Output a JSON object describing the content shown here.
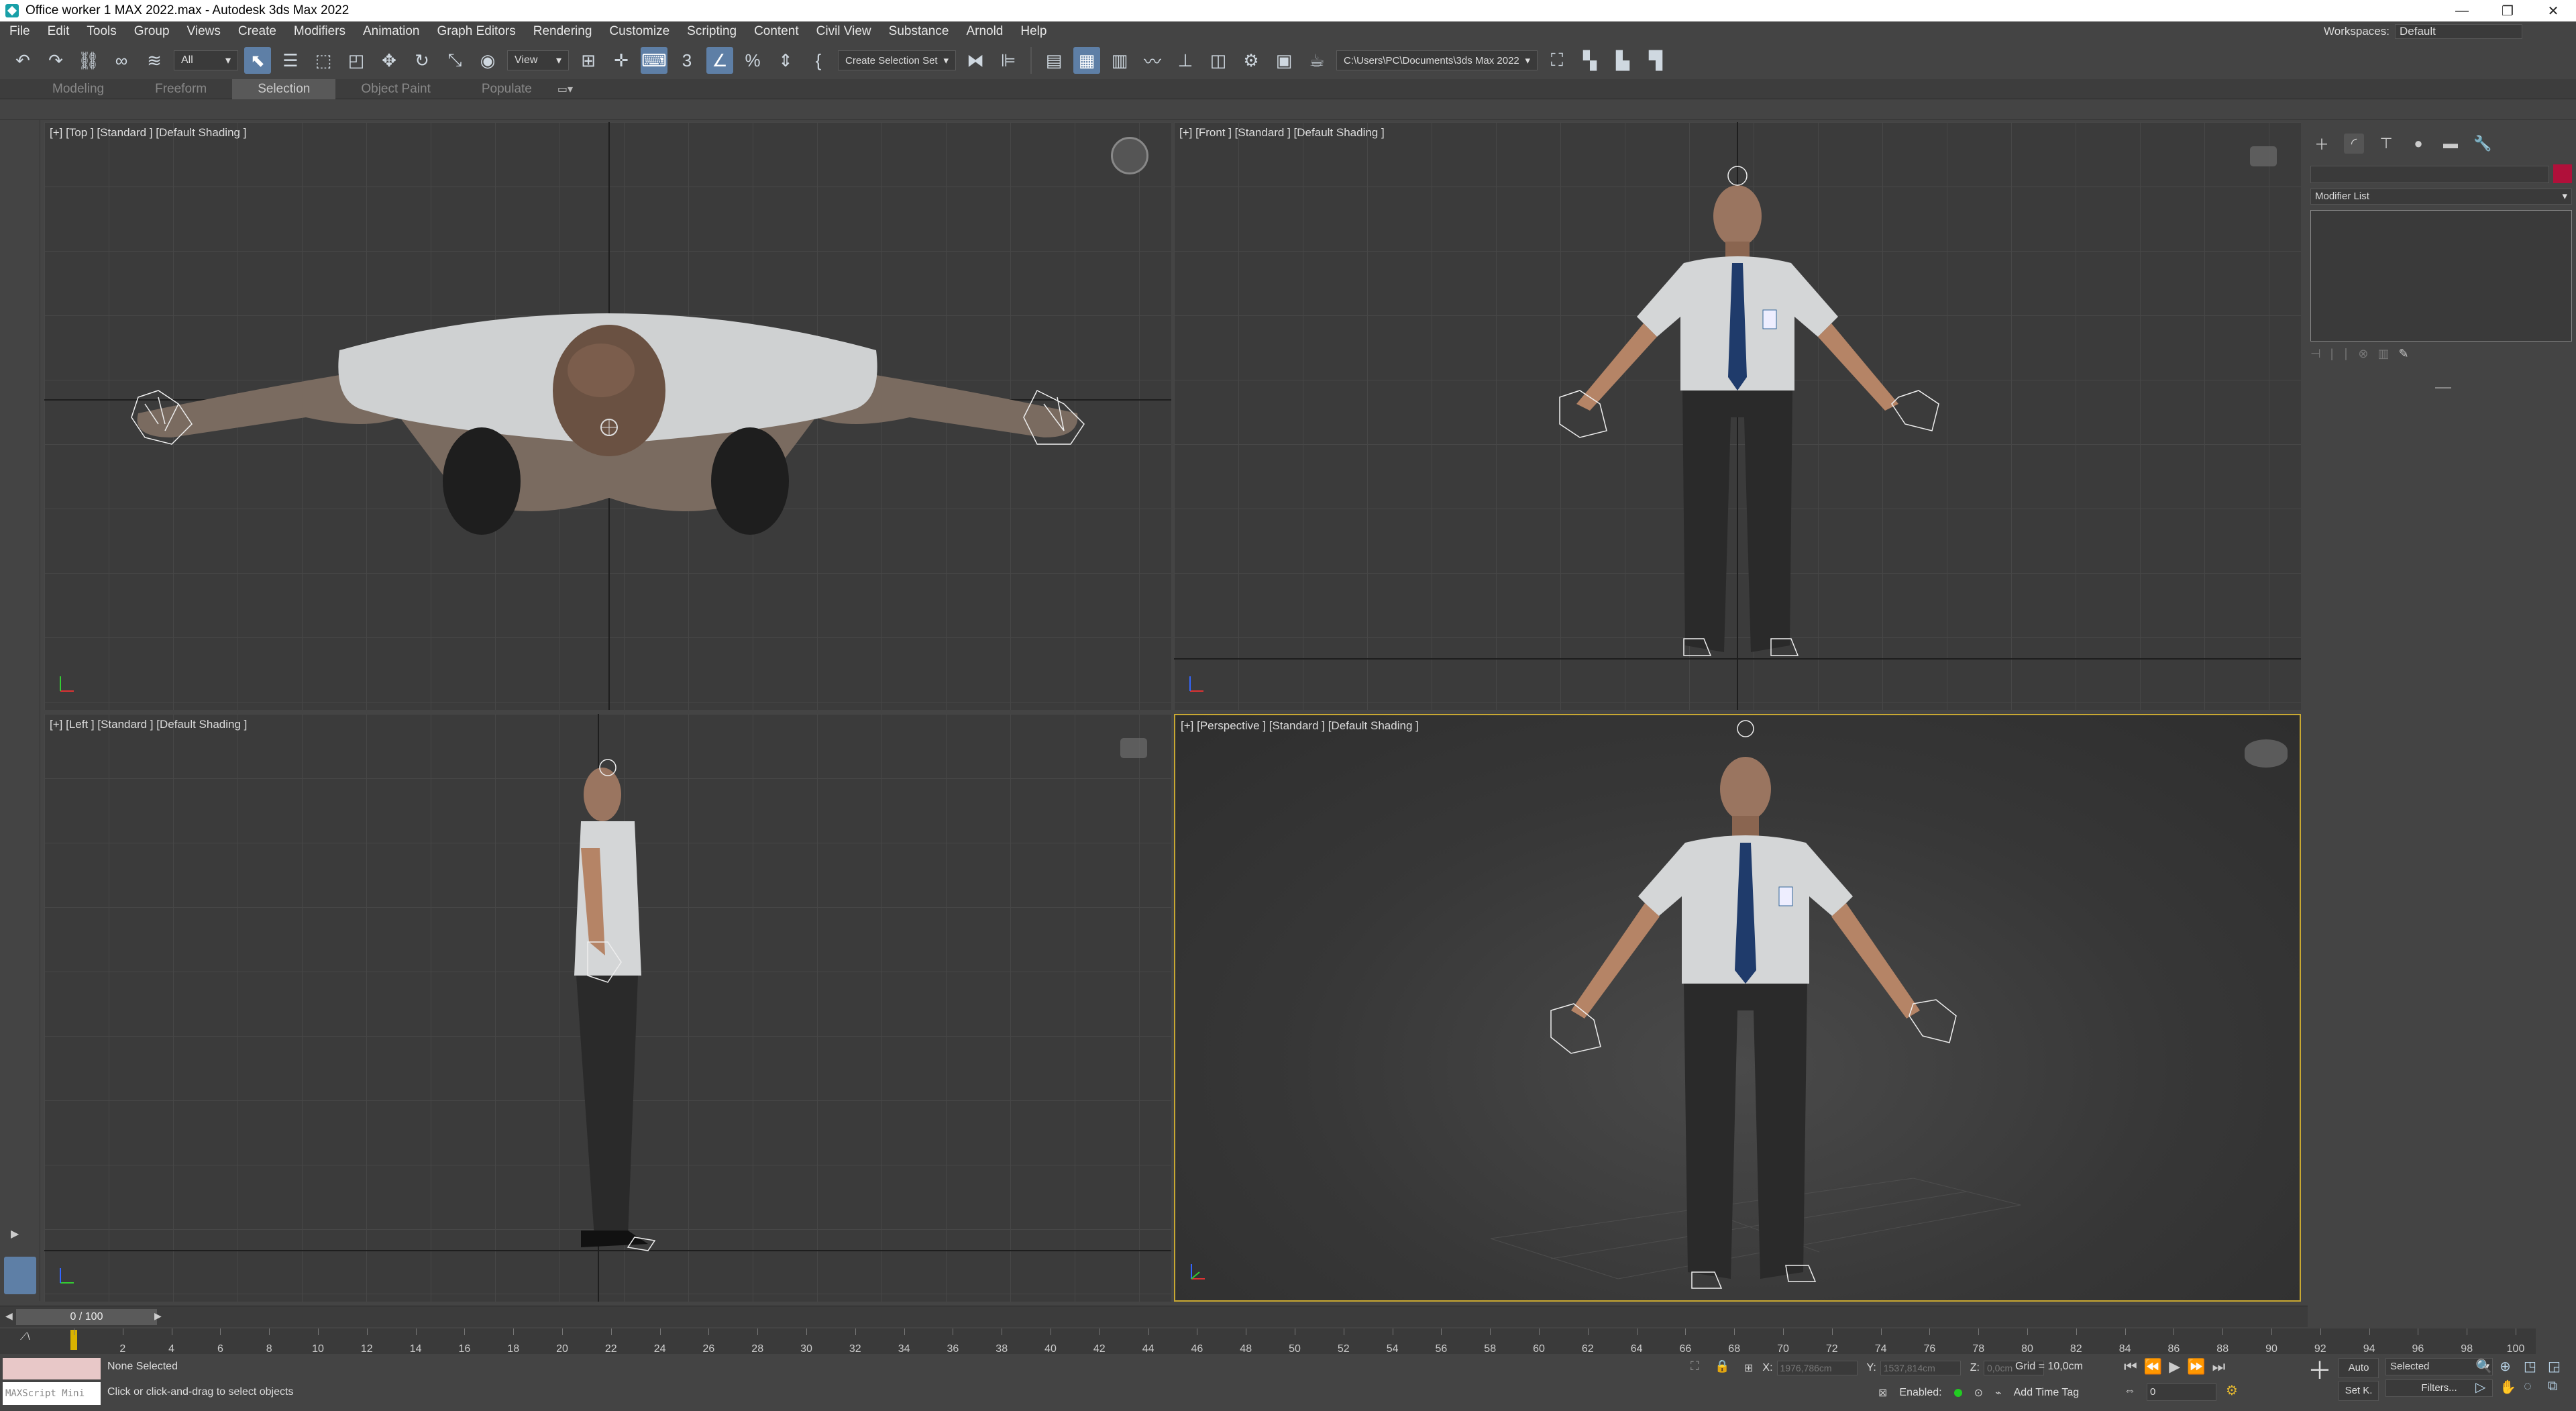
{
  "window": {
    "title": "Office worker 1 MAX 2022.max - Autodesk 3ds Max 2022",
    "controls": [
      "—",
      "❐",
      "✕"
    ]
  },
  "menu": [
    "File",
    "Edit",
    "Tools",
    "Group",
    "Views",
    "Create",
    "Modifiers",
    "Animation",
    "Graph Editors",
    "Rendering",
    "Customize",
    "Scripting",
    "Content",
    "Civil View",
    "Substance",
    "Arnold",
    "Help"
  ],
  "workspace": {
    "label": "Workspaces:",
    "value": "Default"
  },
  "toolbar": {
    "selection_filter": "All",
    "ref_coord": "View",
    "snap_label": "3",
    "selection_set": "Create Selection Set",
    "project_path": "C:\\Users\\PC\\Documents\\3ds Max 2022"
  },
  "ribbon_tabs": [
    "Modeling",
    "Freeform",
    "Selection",
    "Object Paint",
    "Populate"
  ],
  "ribbon_selected": "Selection",
  "viewports": {
    "top": {
      "label": "[+] [Top ] [Standard ] [Default Shading ]"
    },
    "front": {
      "label": "[+] [Front ] [Standard ] [Default Shading ]"
    },
    "left": {
      "label": "[+] [Left ] [Standard ] [Default Shading ]"
    },
    "perspective": {
      "label": "[+] [Perspective ] [Standard ] [Default Shading ]"
    }
  },
  "command_panel": {
    "modifier_list": "Modifier List"
  },
  "time_slider": {
    "value": "0 / 100",
    "current": 0,
    "max": 100
  },
  "trackbar_ticks": [
    0,
    2,
    4,
    6,
    8,
    10,
    12,
    14,
    16,
    18,
    20,
    22,
    24,
    26,
    28,
    30,
    32,
    34,
    36,
    38,
    40,
    42,
    44,
    46,
    48,
    50,
    52,
    54,
    56,
    58,
    60,
    62,
    64,
    66,
    68,
    70,
    72,
    74,
    76,
    78,
    80,
    82,
    84,
    86,
    88,
    90,
    92,
    94,
    96,
    98,
    100
  ],
  "status": {
    "selection": "None Selected",
    "prompt": "Click or click-and-drag to select objects",
    "script_placeholder": "MAXScript Mini",
    "x_label": "X:",
    "x_value": "1976,786cm",
    "y_label": "Y:",
    "y_value": "1537,814cm",
    "z_label": "Z:",
    "z_value": "0,0cm",
    "grid": "Grid = 10,0cm",
    "enabled": "Enabled:",
    "add_time_tag": "Add Time Tag",
    "auto": "Auto",
    "set_key": "Set K.",
    "key_filter": "Selected",
    "filters": "Filters...",
    "frame_field": "0"
  },
  "colors": {
    "object_color": "#b0103a",
    "active_viewport_border": "#c8a832",
    "accent": "#5e7fa6"
  }
}
